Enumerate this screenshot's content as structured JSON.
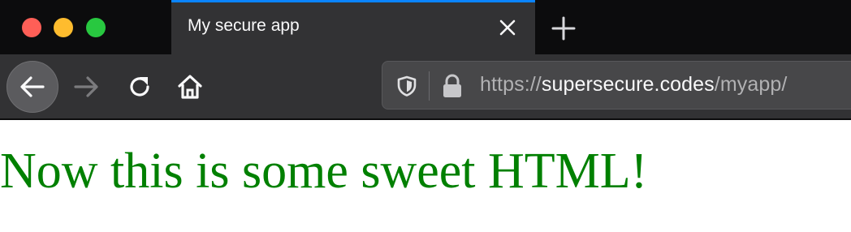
{
  "window": {
    "controls": {
      "close_color": "#ff5f57",
      "minimize_color": "#febc2e",
      "zoom_color": "#28c840"
    }
  },
  "tabs": [
    {
      "title": "My secure app",
      "active": true,
      "close_icon": "close-icon"
    }
  ],
  "new_tab_icon": "plus-icon",
  "toolbar": {
    "back_icon": "arrow-left-icon",
    "forward_icon": "arrow-right-icon",
    "reload_icon": "reload-icon",
    "home_icon": "home-icon"
  },
  "urlbar": {
    "tracking_icon": "shield-icon",
    "lock_icon": "lock-icon",
    "scheme": "https://",
    "host": "supersecure.codes",
    "path": "/myapp/"
  },
  "page": {
    "heading": "Now this is some sweet HTML!",
    "heading_color": "#008000"
  },
  "colors": {
    "accent": "#0a84ff",
    "toolbar": "#323234",
    "titlebar": "#0c0c0d"
  }
}
